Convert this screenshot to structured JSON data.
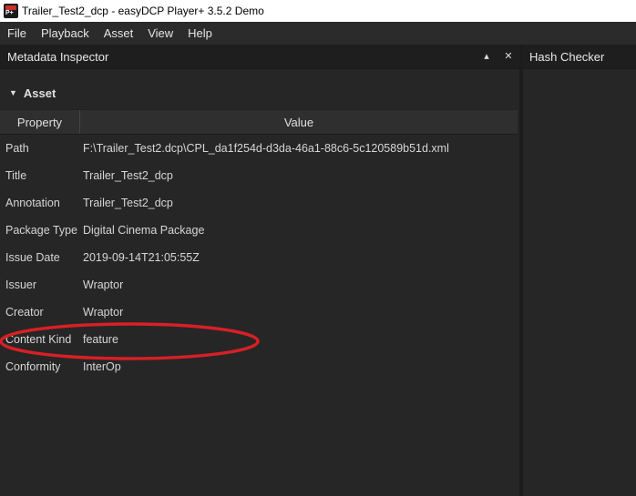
{
  "window": {
    "title": "Trailer_Test2_dcp - easyDCP Player+ 3.5.2 Demo",
    "icon_text": "P+"
  },
  "menu": [
    "File",
    "Playback",
    "Asset",
    "View",
    "Help"
  ],
  "metadata_panel": {
    "title": "Metadata Inspector",
    "pin_icon": "▴",
    "close_icon": "✕",
    "section": {
      "label": "Asset",
      "expanded": true
    },
    "columns": {
      "property": "Property",
      "value": "Value"
    },
    "rows": [
      {
        "key": "Path",
        "value": "F:\\Trailer_Test2.dcp\\CPL_da1f254d-d3da-46a1-88c6-5c120589b51d.xml"
      },
      {
        "key": "Title",
        "value": "Trailer_Test2_dcp"
      },
      {
        "key": "Annotation",
        "value": "Trailer_Test2_dcp"
      },
      {
        "key": "Package Type",
        "value": "Digital Cinema Package"
      },
      {
        "key": "Issue Date",
        "value": "2019-09-14T21:05:55Z"
      },
      {
        "key": "Issuer",
        "value": "Wraptor"
      },
      {
        "key": "Creator",
        "value": "Wraptor"
      },
      {
        "key": "Content Kind",
        "value": "feature"
      },
      {
        "key": "Conformity",
        "value": "InterOp"
      }
    ]
  },
  "hash_panel": {
    "title": "Hash Checker"
  },
  "annotation": {
    "color": "#d81f26",
    "highlighted_row": "Content Kind"
  }
}
